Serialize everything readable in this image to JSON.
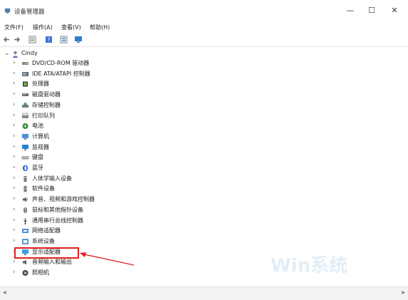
{
  "window": {
    "title": "设备管理器",
    "minimize_icon": "minimize-icon",
    "maximize_icon": "maximize-icon",
    "close_icon": "close-icon"
  },
  "menu": [
    {
      "label": "文件(F)"
    },
    {
      "label": "操作(A)"
    },
    {
      "label": "查看(V)"
    },
    {
      "label": "帮助(H)"
    }
  ],
  "toolbar": [
    "back-arrow-icon",
    "forward-arrow-icon",
    "properties-icon",
    "help-icon",
    "device-view-icon",
    "monitor-icon"
  ],
  "tree": {
    "root": {
      "label": "Cindy",
      "icon": "computer-user-icon"
    },
    "items": [
      {
        "label": "DVD/CD-ROM 驱动器",
        "icon": "dvd-drive-icon"
      },
      {
        "label": "IDE ATA/ATAPI 控制器",
        "icon": "ide-controller-icon"
      },
      {
        "label": "处理器",
        "icon": "processor-icon"
      },
      {
        "label": "磁盘驱动器",
        "icon": "disk-drive-icon"
      },
      {
        "label": "存储控制器",
        "icon": "storage-controller-icon"
      },
      {
        "label": "打印队列",
        "icon": "printer-icon"
      },
      {
        "label": "电池",
        "icon": "battery-icon"
      },
      {
        "label": "计算机",
        "icon": "computer-icon"
      },
      {
        "label": "监视器",
        "icon": "monitor-icon"
      },
      {
        "label": "键盘",
        "icon": "keyboard-icon"
      },
      {
        "label": "蓝牙",
        "icon": "bluetooth-icon"
      },
      {
        "label": "人体学输入设备",
        "icon": "hid-icon"
      },
      {
        "label": "软件设备",
        "icon": "software-device-icon"
      },
      {
        "label": "声音、视频和游戏控制器",
        "icon": "sound-icon"
      },
      {
        "label": "鼠标和其他指针设备",
        "icon": "mouse-icon"
      },
      {
        "label": "通用串行总线控制器",
        "icon": "usb-icon"
      },
      {
        "label": "网络适配器",
        "icon": "network-adapter-icon"
      },
      {
        "label": "系统设备",
        "icon": "system-device-icon"
      },
      {
        "label": "显示适配器",
        "icon": "display-adapter-icon"
      },
      {
        "label": "音频输入和输出",
        "icon": "audio-io-icon"
      },
      {
        "label": "照相机",
        "icon": "camera-icon"
      }
    ]
  },
  "annotation": {
    "target": "显示适配器",
    "color": "#e02020"
  },
  "watermark": "Win系统"
}
